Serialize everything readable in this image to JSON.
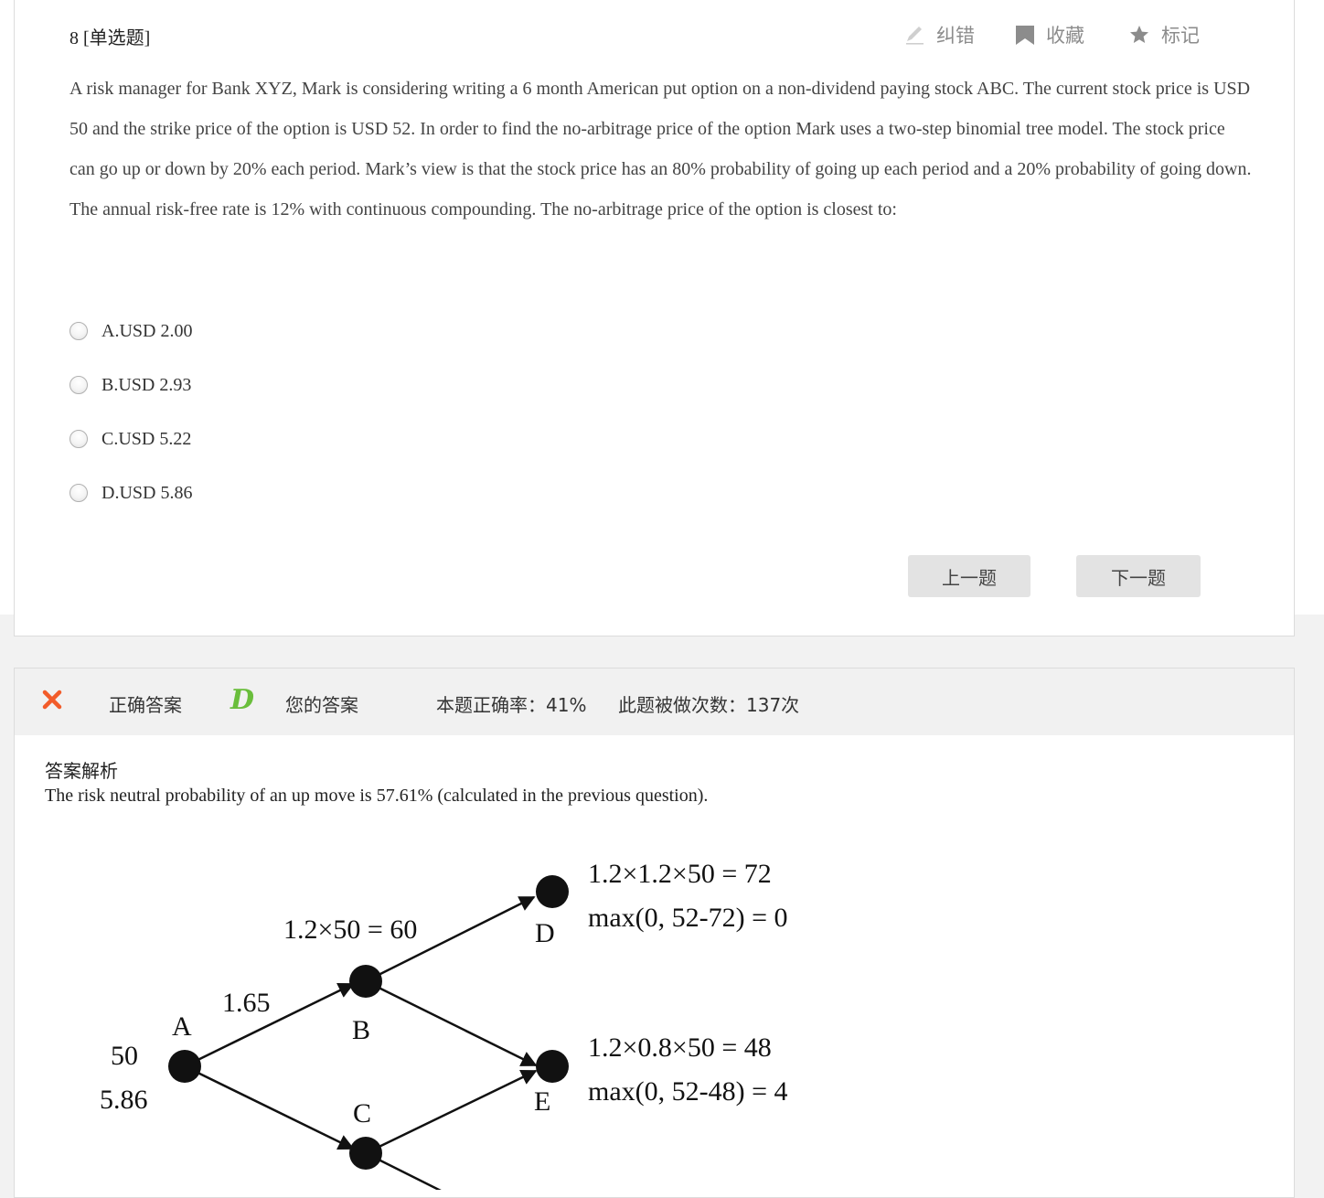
{
  "question": {
    "title": "8 [单选题]",
    "actions": {
      "correct_label": "纠错",
      "favorite_label": "收藏",
      "mark_label": "标记"
    },
    "stem": "A risk manager for Bank XYZ, Mark is considering writing a 6 month American put option on a non-dividend paying stock ABC. The current stock price is USD 50 and the strike price of the option is USD 52. In order to find the no-arbitrage price of the option Mark uses a two-step binomial tree model. The stock price can go up or down by 20% each period. Mark’s view is that the stock price has an 80% probability of going up each period and a 20% probability of going down. The annual risk-free rate is 12% with continuous compounding. The no-arbitrage price of the option is closest to:",
    "options": [
      {
        "label": "A.USD 2.00"
      },
      {
        "label": "B.USD 2.93"
      },
      {
        "label": "C.USD 5.22"
      },
      {
        "label": "D.USD 5.86"
      }
    ],
    "prev_label": "上一题",
    "next_label": "下一题"
  },
  "answer": {
    "correct_answer_label": "正确答案",
    "correct_answer": "D",
    "your_answer_label": "您的答案",
    "your_answer": "",
    "accuracy": "本题正确率：41%",
    "attempts": "此题被做次数：137次",
    "status_color": "#f25c2a",
    "correct_color": "#6abe3c",
    "explanation_title": "答案解析",
    "explanation_text": "The risk neutral probability of an up move is 57.61% (calculated in the previous question).",
    "tree": {
      "node_a": "A",
      "node_b": "B",
      "node_c": "C",
      "node_d": "D",
      "node_e": "E",
      "a_price": "50",
      "a_value": "5.86",
      "b_value": "1.65",
      "b_price": "1.2×50 = 60",
      "d_price": "1.2×1.2×50 = 72",
      "d_payoff": "max(0, 52-72) = 0",
      "e_price": "1.2×0.8×50 = 48",
      "e_payoff": "max(0, 52-48) = 4"
    }
  }
}
